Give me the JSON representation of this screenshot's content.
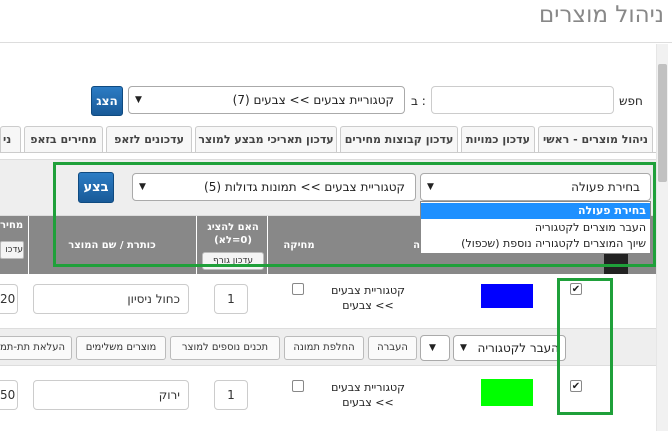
{
  "page": {
    "title": "ניהול מוצרים"
  },
  "search": {
    "label": "חפש",
    "value": "",
    "in_label": "ב :",
    "category_value": "קטגוריית צבעים >> צבעים (7)",
    "button": "הצג"
  },
  "tabs": [
    "ניהול מוצרים - ראשי",
    "עדכון כמויות",
    "עדכון קבוצות מחירים",
    "עדכון תאריכי מבצע למוצר",
    "עדכונים לזאפ",
    "מחירים בזאפ",
    "ני"
  ],
  "toolbar": {
    "action_value": "בחירת פעולה",
    "target_value": "קטגוריית צבעים >> תמונות גדולות (5)",
    "execute_button": "בצע",
    "action_options": [
      "בחירת פעולה",
      "העבר מוצרים לקטגוריה",
      "שיוך המוצרים לקטגוריה נוספת (שכפול)"
    ]
  },
  "table": {
    "headers": {
      "price": "מחיר",
      "price_button": "עדכו",
      "name": "כותרת / שם המוצר",
      "display": "האם להציג (0=לא)",
      "display_button": "עדכון גורף",
      "delete": "מחיקה",
      "category": "ה"
    },
    "rows": [
      {
        "price": "20",
        "name": "כחול ניסיון",
        "display": "1",
        "category": "קטגוריית צבעים >> צבעים",
        "color": "#0000ff",
        "checked": true
      },
      {
        "price": "50",
        "name": "ירוק",
        "display": "1",
        "category": "קטגוריית צבעים >> צבעים",
        "color": "#00ff00",
        "checked": true
      }
    ],
    "row_actions": {
      "move_select": "העבר לקטגוריה",
      "move_button": "העברה",
      "replace_image": "החלפת תמונה",
      "more_content": "תכנים נוספים למוצר",
      "complementary": "מוצרים משלימים",
      "upload_sub": "העלאת תת-תמ"
    }
  }
}
